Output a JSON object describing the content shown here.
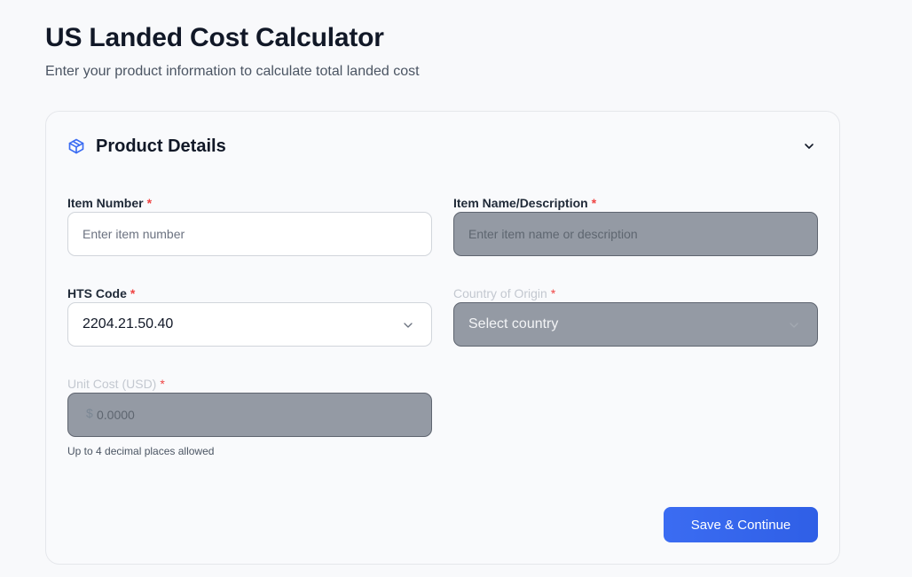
{
  "page": {
    "title": "US Landed Cost Calculator",
    "subtitle": "Enter your product information to calculate total landed cost"
  },
  "card": {
    "title": "Product Details",
    "icon": "package-icon",
    "toggle_icon": "chevron-down-icon",
    "accent": "#3b6cf2"
  },
  "fields": {
    "item_number": {
      "label": "Item Number",
      "required_mark": "*",
      "placeholder": "Enter item number",
      "value": ""
    },
    "item_name": {
      "label": "Item Name/Description",
      "required_mark": "*",
      "placeholder": "Enter item name or description",
      "value": "",
      "disabled": true
    },
    "hts_code": {
      "label": "HTS Code",
      "required_mark": "*",
      "value": "2204.21.50.40"
    },
    "country_of_origin": {
      "label": "Country of Origin",
      "required_mark": "*",
      "value": "Select country",
      "disabled": true
    },
    "unit_cost": {
      "label": "Unit Cost (USD)",
      "required_mark": "*",
      "currency_symbol": "$",
      "placeholder": "0.0000",
      "help": "Up to 4 decimal places allowed",
      "disabled": true
    }
  },
  "actions": {
    "save_label": "Save & Continue"
  }
}
